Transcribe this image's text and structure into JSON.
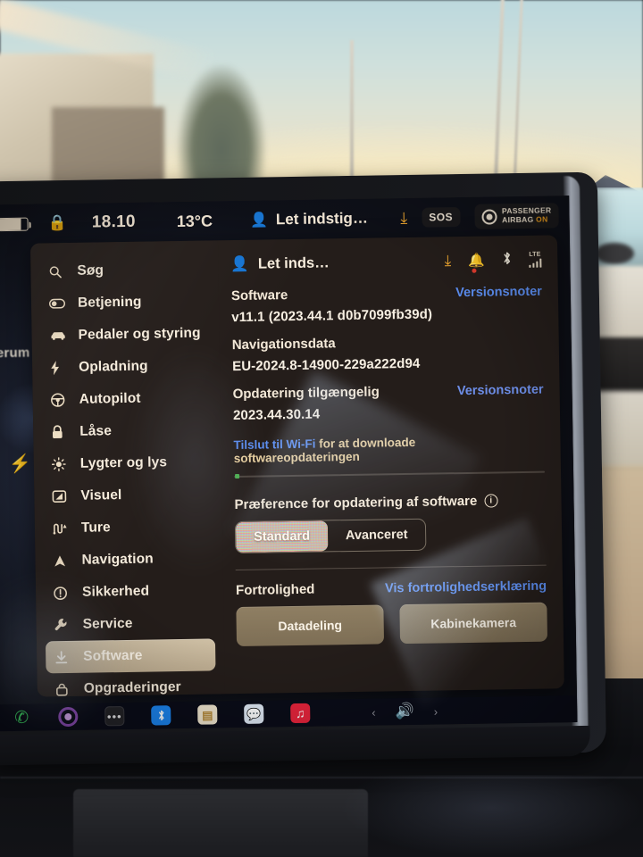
{
  "status_bar": {
    "battery_icon": "battery-icon",
    "lock_icon": "lock-icon",
    "time": "18.10",
    "temperature": "13°C",
    "profile_icon": "person-icon",
    "profile_name": "Let indstig…",
    "download_icon": "download-icon",
    "sos_label": "SOS",
    "airbag_line1": "PASSENGER",
    "airbag_line2": "AIRBAG",
    "airbag_state": "ON"
  },
  "map_background": {
    "location_fragment": "erum",
    "charge_icon": "bolt-icon"
  },
  "sidebar": {
    "items": [
      {
        "label": "Søg",
        "icon": "search-icon",
        "active": false
      },
      {
        "label": "Betjening",
        "icon": "toggle-icon",
        "active": false
      },
      {
        "label": "Pedaler og styring",
        "icon": "car-icon",
        "active": false
      },
      {
        "label": "Opladning",
        "icon": "bolt-icon",
        "active": false
      },
      {
        "label": "Autopilot",
        "icon": "steering-wheel-icon",
        "active": false
      },
      {
        "label": "Låse",
        "icon": "lock-icon",
        "active": false
      },
      {
        "label": "Lygter og lys",
        "icon": "sun-icon",
        "active": false
      },
      {
        "label": "Visuel",
        "icon": "display-icon",
        "active": false
      },
      {
        "label": "Ture",
        "icon": "route-icon",
        "active": false
      },
      {
        "label": "Navigation",
        "icon": "navigation-arrow-icon",
        "active": false
      },
      {
        "label": "Sikkerhed",
        "icon": "exclamation-circle-icon",
        "active": false
      },
      {
        "label": "Service",
        "icon": "wrench-icon",
        "active": false
      },
      {
        "label": "Software",
        "icon": "download-icon",
        "active": true
      },
      {
        "label": "Opgraderinger",
        "icon": "upgrade-bag-icon",
        "active": false
      }
    ]
  },
  "content": {
    "header": {
      "profile_icon": "person-icon",
      "profile_name": "Let inds…",
      "download_icon": "download-icon",
      "bell_icon": "bell-icon",
      "bluetooth_icon": "bluetooth-icon",
      "signal_label": "LTE",
      "signal_icon": "signal-bars-icon"
    },
    "software": {
      "label": "Software",
      "release_notes_link": "Versionsnoter",
      "version": "v11.1 (2023.44.1 d0b7099fb39d)"
    },
    "navigation_data": {
      "label": "Navigationsdata",
      "version": "EU-2024.8-14900-229a222d94"
    },
    "update_available": {
      "label": "Opdatering tilgængelig",
      "release_notes_link": "Versionsnoter",
      "version": "2023.44.30.14"
    },
    "wifi_notice": {
      "link": "Tilslut til Wi-Fi",
      "rest": " for at downloade softwareopdateringen"
    },
    "preference": {
      "label": "Præference for opdatering af software",
      "info_icon": "info-icon",
      "options": [
        {
          "label": "Standard",
          "selected": true
        },
        {
          "label": "Avanceret",
          "selected": false
        }
      ]
    },
    "privacy": {
      "label": "Fortrolighed",
      "statement_link": "Vis fortrolighedserklæring",
      "buttons": [
        {
          "label": "Datadeling"
        },
        {
          "label": "Kabinekamera"
        }
      ]
    }
  },
  "taskbar": {
    "apps": [
      {
        "name": "phone-icon",
        "glyph": "✆"
      },
      {
        "name": "media-dial-icon",
        "glyph": ""
      },
      {
        "name": "more-apps-icon",
        "glyph": "•••"
      },
      {
        "name": "bluetooth-icon",
        "glyph": "✦"
      },
      {
        "name": "notes-icon",
        "glyph": "▤"
      },
      {
        "name": "messages-icon",
        "glyph": "▭"
      },
      {
        "name": "music-icon",
        "glyph": "♫"
      }
    ],
    "prev_track_icon": "chevron-left-icon",
    "volume_icon": "speaker-icon",
    "next_track_icon": "chevron-right-icon"
  },
  "colors": {
    "accent_amber": "#f0a830",
    "link_blue": "#5b8df0",
    "active_pill": "#cfc0a5",
    "dialog_bg": "#241d1a",
    "privacy_button": "#8f7f63",
    "notification_dot": "#e03b2e",
    "progress_dot": "#4caf50"
  }
}
